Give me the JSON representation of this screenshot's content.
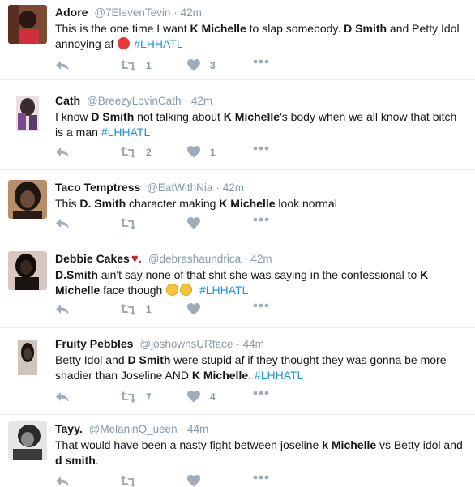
{
  "tweets": [
    {
      "name": "Adore",
      "handle": "@7ElevenTevin",
      "sep": "·",
      "time": "42m",
      "parts": [
        "This is the one time I want ",
        "K Michelle",
        " to slap somebody. ",
        "D Smith",
        " and Petty Idol annoying af ",
        "#LHHATL"
      ],
      "retweets": "1",
      "likes": "3",
      "avatar_colors": [
        "#5a2e20",
        "#d42d3a",
        "#2b1810"
      ]
    },
    {
      "name": "Cath",
      "handle": "@BreezyLovinCath",
      "sep": "·",
      "time": "42m",
      "parts": [
        "I know ",
        "D Smith",
        " not talking about ",
        "K Michelle",
        "'s body when we all know that bitch is a man ",
        "#LHHATL"
      ],
      "retweets": "2",
      "likes": "1",
      "avatar_colors": [
        "#e8dfe3",
        "#7a4a8c",
        "#3a2a2e"
      ]
    },
    {
      "name": "Taco Temptress",
      "handle": "@EatWithNia",
      "sep": "·",
      "time": "42m",
      "parts": [
        "This ",
        "D. Smith",
        " character making ",
        "K Michelle",
        " look normal"
      ],
      "retweets": "",
      "likes": "",
      "avatar_colors": [
        "#6b4b3a",
        "#1f1511",
        "#b88d6a"
      ]
    },
    {
      "name": "Debbie Cakes",
      "heart": "♥.",
      "handle": "@debrashaundrica",
      "sep": "·",
      "time": "42m",
      "parts": [
        "D.Smith",
        " ain't say none of that shit she was saying in the confessional to ",
        "K Michelle",
        " face though ",
        "#LHHATL"
      ],
      "retweets": "1",
      "likes": "",
      "avatar_colors": [
        "#3a2822",
        "#d8c7c0",
        "#120d0b"
      ]
    },
    {
      "name": "Fruity Pebbles",
      "handle": "@joshownsURface",
      "sep": "·",
      "time": "44m",
      "parts": [
        "Betty Idol and ",
        "D Smith",
        " were stupid af if they thought they was gonna be more shadier than Joseline AND ",
        "K Michelle",
        ". ",
        "#LHHATL"
      ],
      "retweets": "7",
      "likes": "4",
      "avatar_colors": [
        "#cfc4be",
        "#4a3a34",
        "#1a1411"
      ]
    },
    {
      "name": "Tayy.",
      "handle": "@MelaninQ_ueen",
      "sep": "·",
      "time": "44m",
      "parts": [
        "That would have been a nasty fight between joseline ",
        "k Michelle",
        " vs Betty idol and  ",
        "d smith",
        "."
      ],
      "retweets": "",
      "likes": "",
      "avatar_colors": [
        "#e6e6e6",
        "#2a2a2a",
        "#8a8a8a"
      ]
    }
  ],
  "icons": {
    "reply": "reply-icon",
    "retweet": "retweet-icon",
    "like": "heart-icon",
    "more": "more-icon"
  },
  "colors": {
    "hashtag": "#1b95e0",
    "action_gray": "#a0adb8",
    "divider": "#e6ecf0",
    "handle_gray": "#8899a6"
  }
}
